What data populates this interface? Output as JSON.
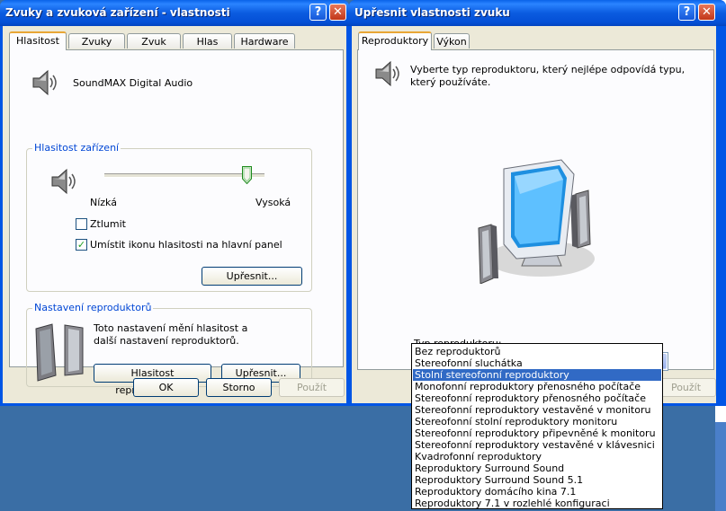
{
  "left_window": {
    "title": "Zvuky a zvuková zařízení - vlastnosti",
    "tabs": [
      "Hlasitost",
      "Zvuky",
      "Zvuk",
      "Hlas",
      "Hardware"
    ],
    "device_name": "SoundMAX Digital Audio",
    "device_volume": {
      "group_label": "Hlasitost zařízení",
      "low_label": "Nízká",
      "high_label": "Vysoká",
      "level_percent": 89,
      "mute_label": "Ztlumit",
      "mute_checked": false,
      "tray_icon_label": "Umístit ikonu hlasitosti na hlavní panel",
      "tray_icon_checked": true,
      "advanced_button": "Upřesnit..."
    },
    "speaker_settings": {
      "group_label": "Nastavení reproduktorů",
      "description": "Toto nastavení mění hlasitost a další nastavení reproduktorů.",
      "volume_button": "Hlasitost reproduktorů...",
      "advanced_button": "Upřesnit..."
    },
    "buttons": {
      "ok": "OK",
      "cancel": "Storno",
      "apply": "Použít"
    }
  },
  "right_window": {
    "title": "Upřesnit vlastnosti zvuku",
    "tabs": [
      "Reproduktory",
      "Výkon"
    ],
    "description": "Vyberte typ reproduktoru, který nejlépe odpovídá typu, který používáte.",
    "type_label": "Typ reproduktoru:",
    "selected_type": "Stolní stereofonní reproduktory",
    "apply_button": "Použít",
    "options": [
      "Bez reproduktorů",
      "Stereofonní sluchátka",
      "Stolní stereofonní reproduktory",
      "Monofonní reproduktory přenosného počítače",
      "Stereofonní reproduktory přenosného počítače",
      "Stereofonní reproduktory vestavěné v monitoru",
      "Stereofonní stolní reproduktory monitoru",
      "Stereofonní reproduktory připevněné k monitoru",
      "Stereofonní reproduktory vestavěné v klávesnici",
      "Kvadrofonní reproduktory",
      "Reproduktory Surround Sound",
      "Reproduktory Surround Sound 5.1",
      "Reproduktory domácího kina 7.1",
      "Reproduktory 7.1 v rozlehlé konfiguraci"
    ],
    "highlighted_index": 2
  },
  "icons": [
    "speaker-icon",
    "speakers-icon",
    "monitor-speakers-icon",
    "help-icon",
    "close-icon",
    "chevron-down-icon",
    "checkmark-icon"
  ],
  "colors": {
    "titlebar": "#0055e5",
    "dialog_bg": "#ece9d8",
    "group_label": "#0046d5",
    "selection": "#316ac5"
  }
}
